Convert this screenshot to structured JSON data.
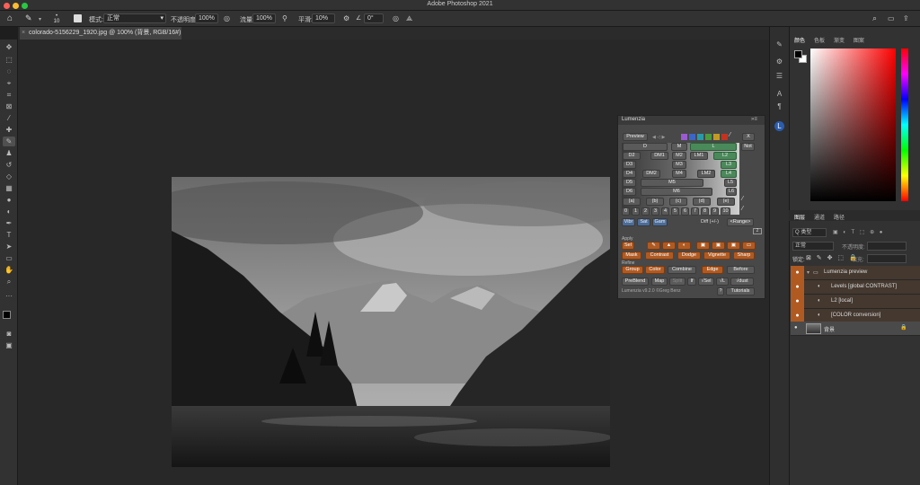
{
  "app": {
    "title": "Adobe Photoshop 2021"
  },
  "options": {
    "brush_size": "10",
    "mode_label": "模式:",
    "mode_value": "正常",
    "opacity_label": "不透明度:",
    "opacity_value": "100%",
    "flow_label": "流量:",
    "flow_value": "100%",
    "smoothing_label": "平滑:",
    "smoothing_value": "10%",
    "angle_value": "0°"
  },
  "document": {
    "tab_label": "colorado-5156229_1920.jpg @ 100% (背景, RGB/16#) *"
  },
  "color_panel": {
    "tabs": [
      "颜色",
      "色板",
      "渐变",
      "图案"
    ],
    "fg": "#000000",
    "bg": "#ffffff"
  },
  "layers_panel": {
    "tabs": [
      "图层",
      "通道",
      "路径"
    ],
    "filter_label": "Q 类型",
    "blend_mode": "正常",
    "opacity_label": "不透明度:",
    "lock_label": "锁定:",
    "fill_label": "填充:",
    "layers": [
      {
        "name": "Lumenzia preview",
        "type": "group"
      },
      {
        "name": "Levels [global CONTRAST]",
        "type": "adjustment"
      },
      {
        "name": "L2 [local]",
        "type": "adjustment"
      },
      {
        "name": "[COLOR conversion]",
        "type": "adjustment"
      },
      {
        "name": "背景",
        "type": "image"
      }
    ]
  },
  "lumenzia": {
    "title": "Lumenzia",
    "preview": "Preview",
    "x_button": "X",
    "not_button": "Not",
    "rows": [
      [
        "D",
        "M",
        "L"
      ],
      [
        "D2",
        "DM1",
        "M2",
        "LM1",
        "L2"
      ],
      [
        "D3",
        "M3",
        "L3"
      ],
      [
        "D4",
        "DM2",
        "M4",
        "LM2",
        "L4"
      ],
      [
        "D5",
        "M5",
        "L5"
      ],
      [
        "D6",
        "M6",
        "L6"
      ]
    ],
    "zone_row": [
      "(a)",
      "(b)",
      "(c)",
      "(d)",
      "(e)"
    ],
    "num_row": [
      "0",
      "1",
      "2",
      "3",
      "4",
      "5",
      "6",
      "7",
      "8",
      "9",
      "10"
    ],
    "vibe_row": [
      "Vibr",
      "Sat",
      "Gam"
    ],
    "diff": "Diff (+/-)",
    "range": "<Range>",
    "apply_label": "Apply",
    "sel": "Sel",
    "apply_row": [
      "Mask",
      "Contrast",
      "Dodge",
      "Vignette",
      "Sharp"
    ],
    "refine_label": "Refine",
    "refine_row": [
      "Group",
      "Color",
      "Combine",
      "Edge",
      "Before"
    ],
    "bottom_row": [
      "PreBlend",
      "Map",
      "Split",
      "If",
      "√Sel",
      "√L",
      "√dust"
    ],
    "version": "Lumenzia v9.2.0 ©Greg Benz",
    "help": "?",
    "tutorials": "Tutorials",
    "page_number": "2"
  }
}
